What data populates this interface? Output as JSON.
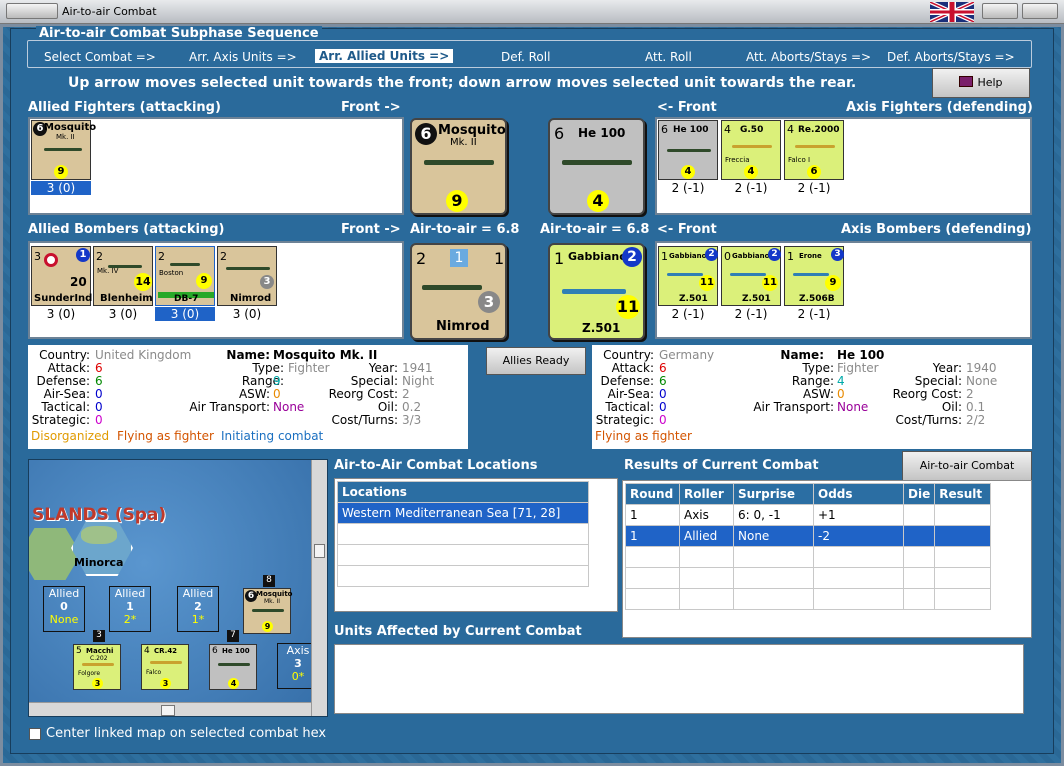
{
  "window": {
    "title": "Air-to-air Combat"
  },
  "sequence": {
    "title": "Air-to-air Combat Subphase Sequence",
    "steps": [
      "Select Combat =>",
      "Arr. Axis Units =>",
      "Arr. Allied Units =>",
      "Def. Roll",
      "Att. Roll",
      "Att. Aborts/Stays =>",
      "Def. Aborts/Stays =>"
    ],
    "selected": 2
  },
  "instructions": "Up arrow moves selected unit towards the front; down arrow moves selected unit towards the rear.",
  "help_label": "Help",
  "allied_fighters": {
    "title": "Allied Fighters (attacking)",
    "front": "Front ->",
    "units": [
      {
        "name": "Mosquito",
        "sub": "Mk. II",
        "top": "6",
        "val": "9",
        "str": "3 (0)",
        "selected": true
      }
    ]
  },
  "axis_fighters": {
    "title": "Axis Fighters (defending)",
    "front": "<- Front",
    "units": [
      {
        "name": "He 100",
        "top": "6",
        "val": "4",
        "str": "2 (-1)"
      },
      {
        "name": "G.50",
        "sub": "Freccia",
        "top": "4",
        "val": "4",
        "str": "2 (-1)"
      },
      {
        "name": "Re.2000",
        "sub": "Falco I",
        "top": "4",
        "val": "6",
        "str": "2 (-1)"
      }
    ]
  },
  "allied_bombers": {
    "title": "Allied Bombers (attacking)",
    "front": "Front ->",
    "units": [
      {
        "name": "SunderInd",
        "top": "3",
        "val": "20",
        "str": "3 (0)",
        "badge": "1"
      },
      {
        "name": "Blenheim",
        "sub": "Mk. IV",
        "top": "2",
        "val": "14",
        "str": "3 (0)"
      },
      {
        "name": "DB-7",
        "sub": "Boston",
        "top": "2",
        "val": "9",
        "str": "3 (0)",
        "selected": true
      },
      {
        "name": "Nimrod",
        "top": "2",
        "val": "3",
        "str": "3 (0)"
      }
    ]
  },
  "axis_bombers": {
    "title": "Axis Bombers (defending)",
    "front": "<- Front",
    "units": [
      {
        "name": "Gabbiano",
        "sub": "Z.501",
        "top": "1",
        "val": "11",
        "str": "2 (-1)",
        "badge": "2"
      },
      {
        "name": "Gabbiano",
        "sub": "Z.501",
        "top": "0",
        "val": "11",
        "str": "2 (-1)",
        "badge": "2"
      },
      {
        "name": "Erone",
        "sub": "Z.506B",
        "top": "1",
        "val": "9",
        "str": "2 (-1)",
        "badge": "3"
      }
    ]
  },
  "big_cards": {
    "allied_fighter": {
      "name": "Mosquito",
      "sub": "Mk. II",
      "top": "6",
      "val": "9"
    },
    "axis_fighter": {
      "name": "He 100",
      "top": "6",
      "val": "4"
    },
    "allied_bomber": {
      "name": "Nimrod",
      "top": "2",
      "right": "1",
      "mid": "1",
      "val": "3"
    },
    "axis_bomber": {
      "name": "Gabbiano",
      "sub": "Z.501",
      "top": "1",
      "badge": "2",
      "val": "11"
    }
  },
  "air_to_air_left": "Air-to-air = 6.8",
  "air_to_air_right": "Air-to-air = 6.8",
  "allies_ready": "Allies Ready",
  "allied_info": {
    "country": "United Kingdom",
    "name": "Mosquito Mk. II",
    "attack": "6",
    "defense": "6",
    "air_sea": "0",
    "tactical": "0",
    "strategic": "0",
    "type": "Fighter",
    "range": "9",
    "asw": "0",
    "air_transport": "None",
    "year": "1941",
    "special": "Night",
    "reorg": "2",
    "oil": "0.2",
    "cost": "3/3",
    "status1": "Disorganized",
    "status2": "Flying as fighter",
    "status3": "Initiating combat"
  },
  "axis_info": {
    "country": "Germany",
    "name": "He 100",
    "attack": "6",
    "defense": "6",
    "air_sea": "0",
    "tactical": "0",
    "strategic": "0",
    "type": "Fighter",
    "range": "4",
    "asw": "0",
    "air_transport": "None",
    "year": "1940",
    "special": "None",
    "reorg": "2",
    "oil": "0.1",
    "cost": "2/2",
    "status1": "Flying as fighter"
  },
  "labels": {
    "country": "Country:",
    "name": "Name:",
    "attack": "Attack:",
    "defense": "Defense:",
    "air_sea": "Air-Sea:",
    "tactical": "Tactical:",
    "strategic": "Strategic:",
    "type": "Type:",
    "range": "Range:",
    "asw": "ASW:",
    "air_transport": "Air Transport:",
    "year": "Year:",
    "special": "Special:",
    "reorg": "Reorg Cost:",
    "oil": "Oil:",
    "cost": "Cost/Turns:"
  },
  "map": {
    "region": "SLANDS (Spa)",
    "hex": "Minorca",
    "boxes": [
      {
        "side": "Allied",
        "num": "0",
        "sub": "None"
      },
      {
        "side": "Allied",
        "num": "1",
        "sub": "2*"
      },
      {
        "side": "Allied",
        "num": "2",
        "sub": "1*"
      },
      {
        "side": "Axis",
        "num": "3",
        "sub": "0*"
      }
    ],
    "stack_counts": [
      "8",
      "3",
      "7"
    ],
    "counters": [
      {
        "name": "Mosquito",
        "sub": "Mk. II",
        "top": "6",
        "val": "9"
      },
      {
        "name": "Macchi",
        "sub": "C.202",
        "extra": "Folgore",
        "top": "5",
        "val": "3"
      },
      {
        "name": "CR.42",
        "sub": "Falco",
        "top": "4",
        "val": "3"
      },
      {
        "name": "He 100",
        "top": "6",
        "val": "4"
      }
    ],
    "center_label": "Center linked map on selected combat hex"
  },
  "locations": {
    "title": "Air-to-Air Combat Locations",
    "header": "Locations",
    "rows": [
      "Western Mediterranean Sea [71, 28]"
    ]
  },
  "results": {
    "title": "Results of Current Combat",
    "chart_button": "Air-to-air Combat Chart",
    "columns": [
      "Round",
      "Roller",
      "Surprise",
      "Odds",
      "Die",
      "Result"
    ],
    "rows": [
      [
        "1",
        "Axis",
        "6: 0, -1",
        "+1",
        "",
        ""
      ],
      [
        "1",
        "Allied",
        "None",
        "-2",
        "",
        ""
      ]
    ]
  },
  "affected": {
    "title": "Units Affected by Current Combat"
  }
}
